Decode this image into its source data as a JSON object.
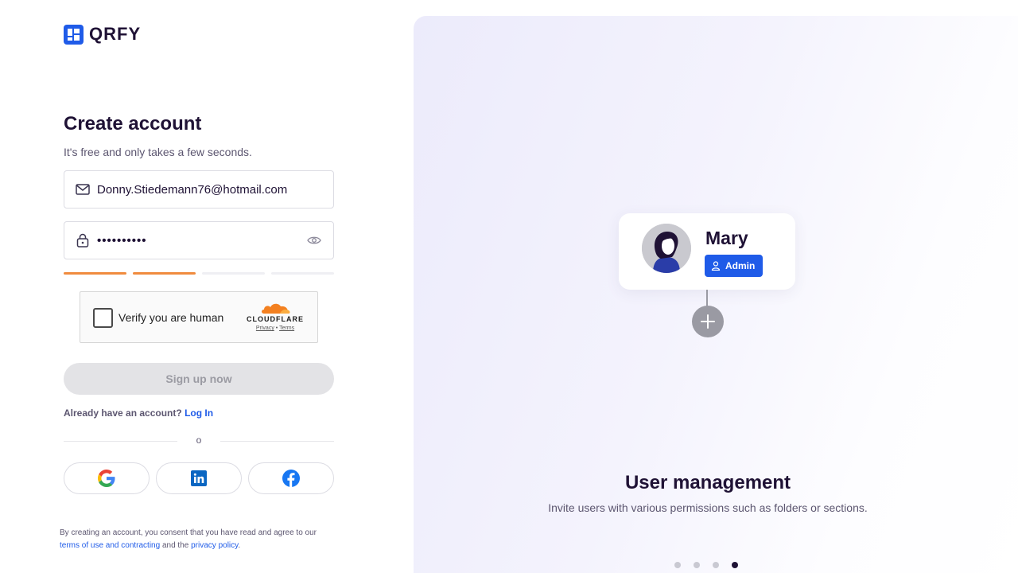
{
  "brand": {
    "name": "QRFY",
    "color": "#1f5be8"
  },
  "form": {
    "title": "Create account",
    "subtitle": "It's free and only takes a few seconds.",
    "email_value": "Donny.Stiedemann76@hotmail.com",
    "password_value": "••••••••••",
    "strength_filled": 2,
    "strength_total": 4,
    "strength_color": "#f08b3e"
  },
  "captcha": {
    "label": "Verify you are human",
    "provider": "CLOUDFLARE",
    "privacy": "Privacy",
    "separator": "•",
    "terms": "Terms"
  },
  "signup_button": "Sign up now",
  "login": {
    "prompt": "Already have an account?",
    "link": "Log In"
  },
  "divider_text": "o",
  "social": [
    {
      "name": "Google",
      "icon": "google-icon"
    },
    {
      "name": "LinkedIn",
      "icon": "linkedin-icon"
    },
    {
      "name": "Facebook",
      "icon": "facebook-icon"
    }
  ],
  "terms": {
    "prefix": "By creating an account, you consent that you have read and agree to our",
    "terms_link": "terms of use and contracting",
    "middle": "and the",
    "privacy_link": "privacy policy",
    "suffix": "."
  },
  "showcase": {
    "user_name": "Mary",
    "role": "Admin",
    "title": "User management",
    "subtitle": "Invite users with various permissions such as folders or sections.",
    "slides": 4,
    "active_slide": 4
  }
}
